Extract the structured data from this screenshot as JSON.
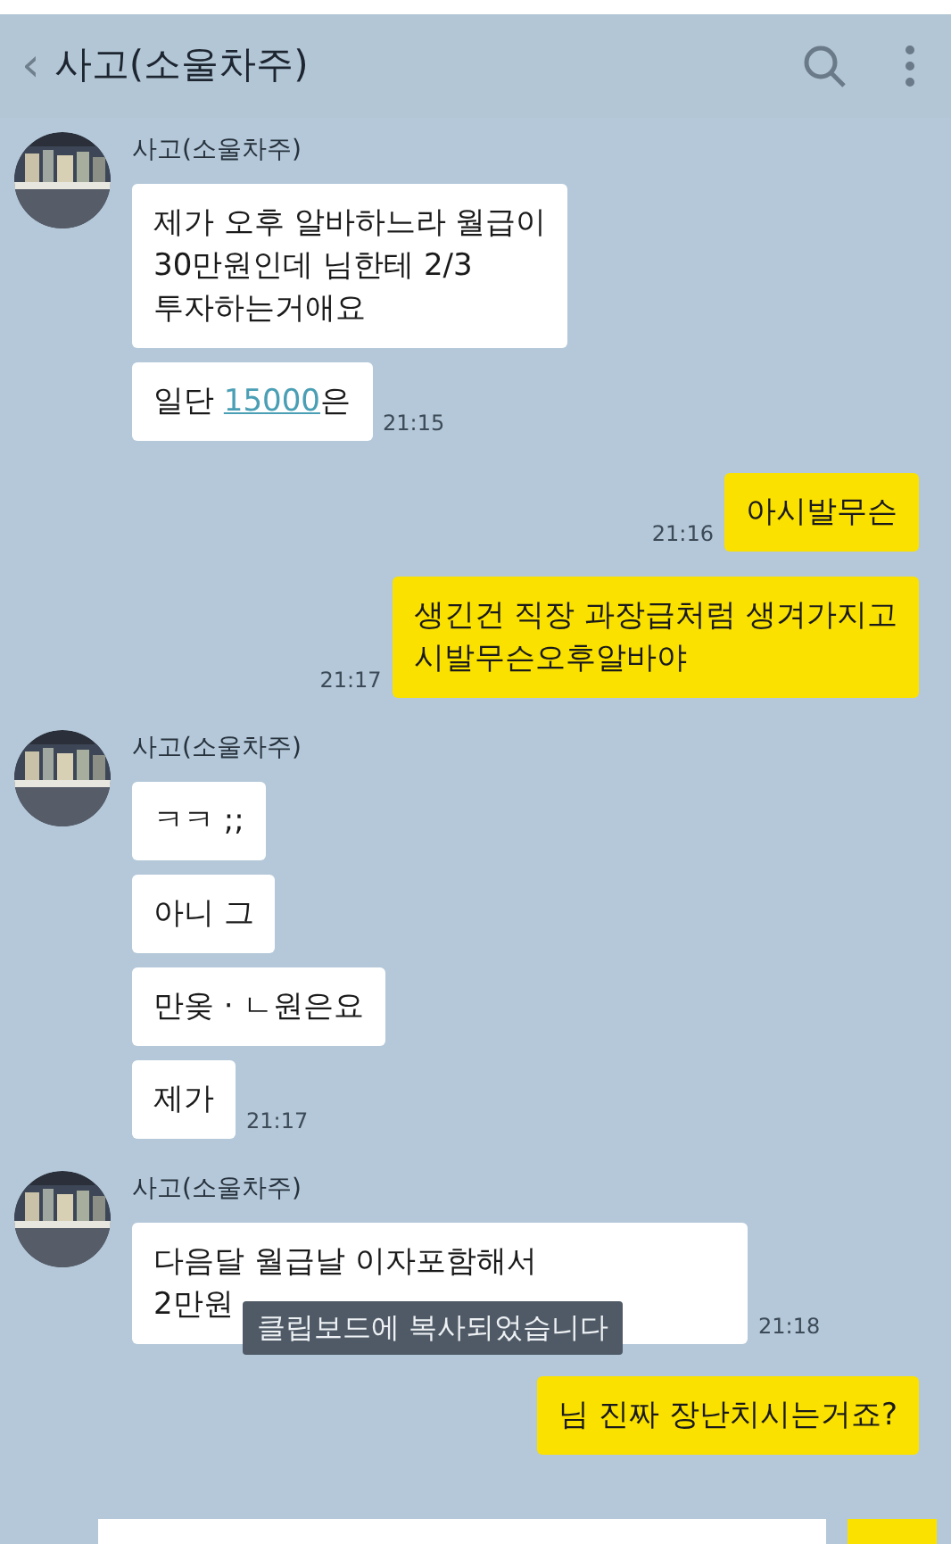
{
  "header": {
    "back": "‹",
    "title": "사고(소울차주)"
  },
  "groups": [
    {
      "kind": "received",
      "sender": "사고(소울차주)",
      "messages": [
        {
          "parts": [
            {
              "text": "제가 오후 알바하느라 월급이\n30만원인데 님한테 2/3\n투자하는거애요"
            }
          ]
        },
        {
          "parts": [
            {
              "text": "일단 "
            },
            {
              "text": "15000",
              "kind": "link"
            },
            {
              "text": "은"
            }
          ],
          "time": "21:15"
        }
      ]
    },
    {
      "kind": "sent",
      "messages": [
        {
          "parts": [
            {
              "text": "아시발무슨"
            }
          ],
          "time": "21:16"
        },
        {
          "parts": [
            {
              "text": "생긴건 직장 과장급처럼 생겨가지고\n시발무슨오후알바야"
            }
          ],
          "time": "21:17"
        }
      ]
    },
    {
      "kind": "received",
      "sender": "사고(소울차주)",
      "messages": [
        {
          "parts": [
            {
              "text": "ㅋㅋ ;;"
            }
          ]
        },
        {
          "parts": [
            {
              "text": "아니 그"
            }
          ]
        },
        {
          "parts": [
            {
              "text": "만옺 · ㄴ원은요"
            }
          ]
        },
        {
          "parts": [
            {
              "text": "제가"
            }
          ],
          "time": "21:17"
        }
      ]
    },
    {
      "kind": "received",
      "sender": "사고(소울차주)",
      "messages": [
        {
          "parts": [
            {
              "text": "다음달 월급날 이자포함해서\n2만원"
            }
          ],
          "time": "21:18",
          "toast": "클립보드에 복사되었습니다"
        }
      ]
    },
    {
      "kind": "sent",
      "messages": [
        {
          "parts": [
            {
              "text": "님 진짜 장난치시는거죠?"
            }
          ]
        }
      ]
    }
  ]
}
